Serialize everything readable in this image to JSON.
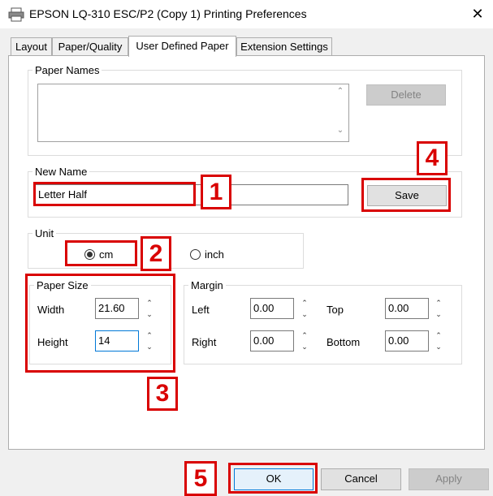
{
  "window": {
    "title": "EPSON LQ-310 ESC/P2 (Copy 1) Printing Preferences",
    "close_glyph": "✕",
    "printer_icon": "printer-icon"
  },
  "tabs": [
    {
      "label": "Layout"
    },
    {
      "label": "Paper/Quality"
    },
    {
      "label": "User Defined Paper",
      "active": true
    },
    {
      "label": "Extension Settings"
    }
  ],
  "paper_names": {
    "legend": "Paper Names",
    "items": [],
    "delete_label": "Delete"
  },
  "new_name": {
    "legend": "New Name",
    "value": "Letter Half",
    "save_label": "Save"
  },
  "unit": {
    "legend": "Unit",
    "options": [
      {
        "label": "cm",
        "selected": true
      },
      {
        "label": "inch",
        "selected": false
      }
    ]
  },
  "paper_size": {
    "legend": "Paper Size",
    "width_label": "Width",
    "width_value": "21.60",
    "height_label": "Height",
    "height_value": "14"
  },
  "margin": {
    "legend": "Margin",
    "left_label": "Left",
    "left_value": "0.00",
    "top_label": "Top",
    "top_value": "0.00",
    "right_label": "Right",
    "right_value": "0.00",
    "bottom_label": "Bottom",
    "bottom_value": "0.00"
  },
  "footer": {
    "ok_label": "OK",
    "cancel_label": "Cancel",
    "apply_label": "Apply"
  },
  "annotations": {
    "step1": "1",
    "step2": "2",
    "step3": "3",
    "step4": "4",
    "step5": "5",
    "color": "#d90000"
  },
  "spin_glyphs": {
    "up": "⌃",
    "down": "⌄"
  },
  "scroll_glyphs": {
    "up": "⌃",
    "down": "⌄"
  }
}
